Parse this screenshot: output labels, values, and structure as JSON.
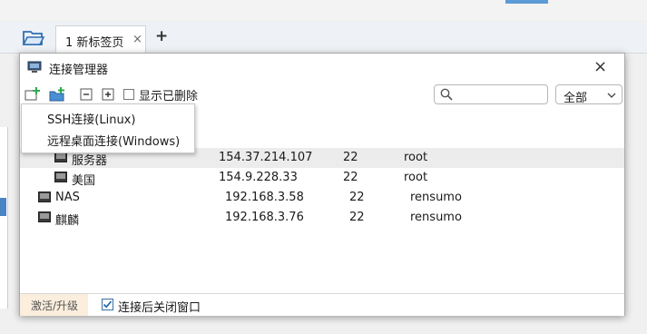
{
  "tabs": [
    {
      "label": "1 新标签页",
      "close": "×"
    }
  ],
  "tab_add": "+",
  "dialog": {
    "title": "连接管理器",
    "close": "×",
    "toolbar": {
      "show_deleted_label": "显示已删除",
      "search_placeholder": "",
      "filter_value": "全部"
    },
    "tree": [
      {
        "name": "服务器",
        "host": "154.37.214.107",
        "port": "22",
        "user": "root",
        "selected": true
      },
      {
        "name": "美国",
        "host": "154.9.228.33",
        "port": "22",
        "user": "root",
        "selected": false
      },
      {
        "name": "NAS",
        "host": "192.168.3.58",
        "port": "22",
        "user": "rensumo",
        "selected": false
      },
      {
        "name": "麒麟",
        "host": "192.168.3.76",
        "port": "22",
        "user": "rensumo",
        "selected": false
      }
    ],
    "status": {
      "activate_label": "激活/升级",
      "close_after_connect_label": "连接后关闭窗口",
      "close_after_connect_checked": true
    }
  },
  "popup_menu": [
    {
      "label": "SSH连接(Linux)"
    },
    {
      "label": "远程桌面连接(Windows)"
    }
  ],
  "colors": {
    "accent": "#5c9bd6",
    "selected_row": "#ececec",
    "activate_bg": "#fbeedd"
  }
}
